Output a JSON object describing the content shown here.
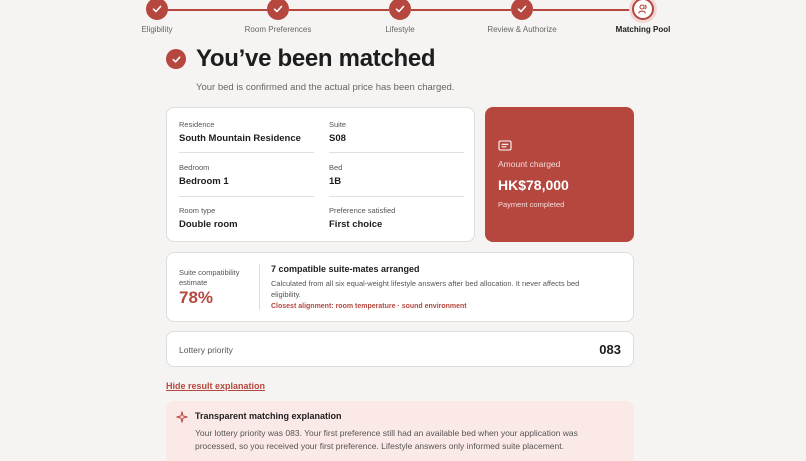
{
  "stepper": {
    "steps": [
      {
        "label": "Eligibility",
        "state": "done"
      },
      {
        "label": "Room Preferences",
        "state": "done"
      },
      {
        "label": "Lifestyle",
        "state": "done"
      },
      {
        "label": "Review & Authorize",
        "state": "done"
      },
      {
        "label": "Matching Pool",
        "state": "current"
      }
    ]
  },
  "header": {
    "title": "You’ve been matched",
    "subtitle": "Your bed is confirmed and the actual price has been charged."
  },
  "details": {
    "residence": {
      "label": "Residence",
      "value": "South Mountain Residence"
    },
    "suite": {
      "label": "Suite",
      "value": "S08"
    },
    "bedroom": {
      "label": "Bedroom",
      "value": "Bedroom 1"
    },
    "bed": {
      "label": "Bed",
      "value": "1B"
    },
    "room_type": {
      "label": "Room type",
      "value": "Double room"
    },
    "preference": {
      "label": "Preference satisfied",
      "value": "First choice"
    }
  },
  "amount": {
    "label": "Amount charged",
    "value": "HK$78,000",
    "status": "Payment completed"
  },
  "compatibility": {
    "label": "Suite compatibility estimate",
    "value": "78%",
    "title": "7 compatible suite-mates arranged",
    "description": "Calculated from all six equal-weight lifestyle answers after bed allocation. It never affects bed eligibility.",
    "alignment": "Closest alignment: room temperature · sound environment"
  },
  "lottery": {
    "label": "Lottery priority",
    "value": "083"
  },
  "explanation": {
    "toggle_label": "Hide result explanation",
    "title": "Transparent matching explanation",
    "text": "Your lottery priority was 083. Your first preference still had an available bed when your application was processed, so you received your first preference. Lifestyle answers only informed suite placement."
  },
  "colors": {
    "accent": "#b5473f",
    "explain_bg": "#fbe9e7"
  }
}
